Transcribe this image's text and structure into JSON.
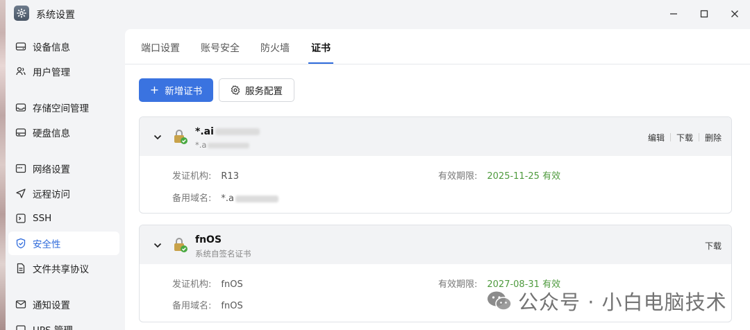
{
  "window": {
    "title": "系统设置"
  },
  "sidebar": {
    "items": [
      {
        "label": "设备信息",
        "icon": "device-icon"
      },
      {
        "label": "用户管理",
        "icon": "users-icon"
      },
      {
        "label": "存储空间管理",
        "icon": "storage-icon"
      },
      {
        "label": "硬盘信息",
        "icon": "disk-icon"
      },
      {
        "label": "网络设置",
        "icon": "network-icon"
      },
      {
        "label": "远程访问",
        "icon": "send-icon"
      },
      {
        "label": "SSH",
        "icon": "terminal-icon"
      },
      {
        "label": "安全性",
        "icon": "shield-icon",
        "active": true
      },
      {
        "label": "文件共享协议",
        "icon": "file-share-icon"
      },
      {
        "label": "通知设置",
        "icon": "mail-icon"
      },
      {
        "label": "UPS 管理",
        "icon": "ups-icon"
      }
    ]
  },
  "tabs": [
    "端口设置",
    "账号安全",
    "防火墙",
    "证书"
  ],
  "active_tab": "证书",
  "toolbar": {
    "add_label": "新增证书",
    "service_label": "服务配置"
  },
  "certs": [
    {
      "name": "*.ai",
      "subtitle": "*.a",
      "actions": [
        "编辑",
        "下载",
        "删除"
      ],
      "issuer_label": "发证机构:",
      "issuer": "R13",
      "validity_label": "有效期限:",
      "validity": "2025-11-25 有效",
      "alt_label": "备用域名:",
      "alt": "*.a"
    },
    {
      "name": "fnOS",
      "subtitle": "系统自签名证书",
      "actions": [
        "下载"
      ],
      "issuer_label": "发证机构:",
      "issuer": "fnOS",
      "validity_label": "有效期限:",
      "validity": "2027-08-31 有效",
      "alt_label": "备用域名:",
      "alt": "fnOS"
    }
  ],
  "watermark": "公众号 · 小白电脑技术",
  "colors": {
    "accent": "#3a73e0",
    "valid": "#4e9a3d"
  }
}
